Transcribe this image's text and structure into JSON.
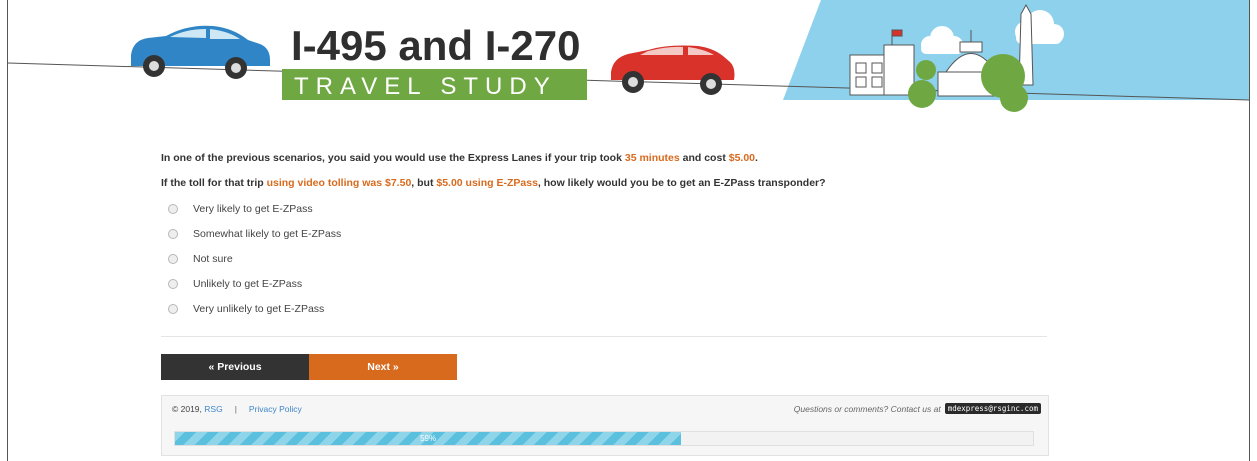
{
  "header": {
    "title_line1": "I-495 and I-270",
    "title_line2": "TRAVEL STUDY",
    "colors": {
      "sky": "#8ed1ec",
      "green": "#6fa843",
      "blue_car": "#2f85c6",
      "red_car": "#d9322b"
    }
  },
  "question": {
    "line1": {
      "pre": "In one of the previous scenarios, you said you would use the Express Lanes if your trip took ",
      "time": "35 minutes",
      "mid": " and cost ",
      "cost": "$5.00",
      "post": "."
    },
    "line2": {
      "pre": "If the toll for that trip ",
      "video": "using video tolling was $7.50",
      "mid": ", but ",
      "ezpass": "$5.00 using E-ZPass",
      "post": ", how likely would you be to get an E-ZPass transponder?"
    }
  },
  "options": [
    "Very likely to get E-ZPass",
    "Somewhat likely to get E-ZPass",
    "Not sure",
    "Unlikely to get E-ZPass",
    "Very unlikely to get E-ZPass"
  ],
  "buttons": {
    "previous": "« Previous",
    "next": "Next »"
  },
  "footer": {
    "copyright": "© 2019, ",
    "rsg": "RSG",
    "separator": "|",
    "privacy": "Privacy Policy",
    "contact": "Questions or comments? Contact us at",
    "email": "mdexpress@rsginc.com"
  },
  "progress": {
    "label": "59%",
    "fraction": 0.59
  },
  "accent_color": "#d86a1e"
}
